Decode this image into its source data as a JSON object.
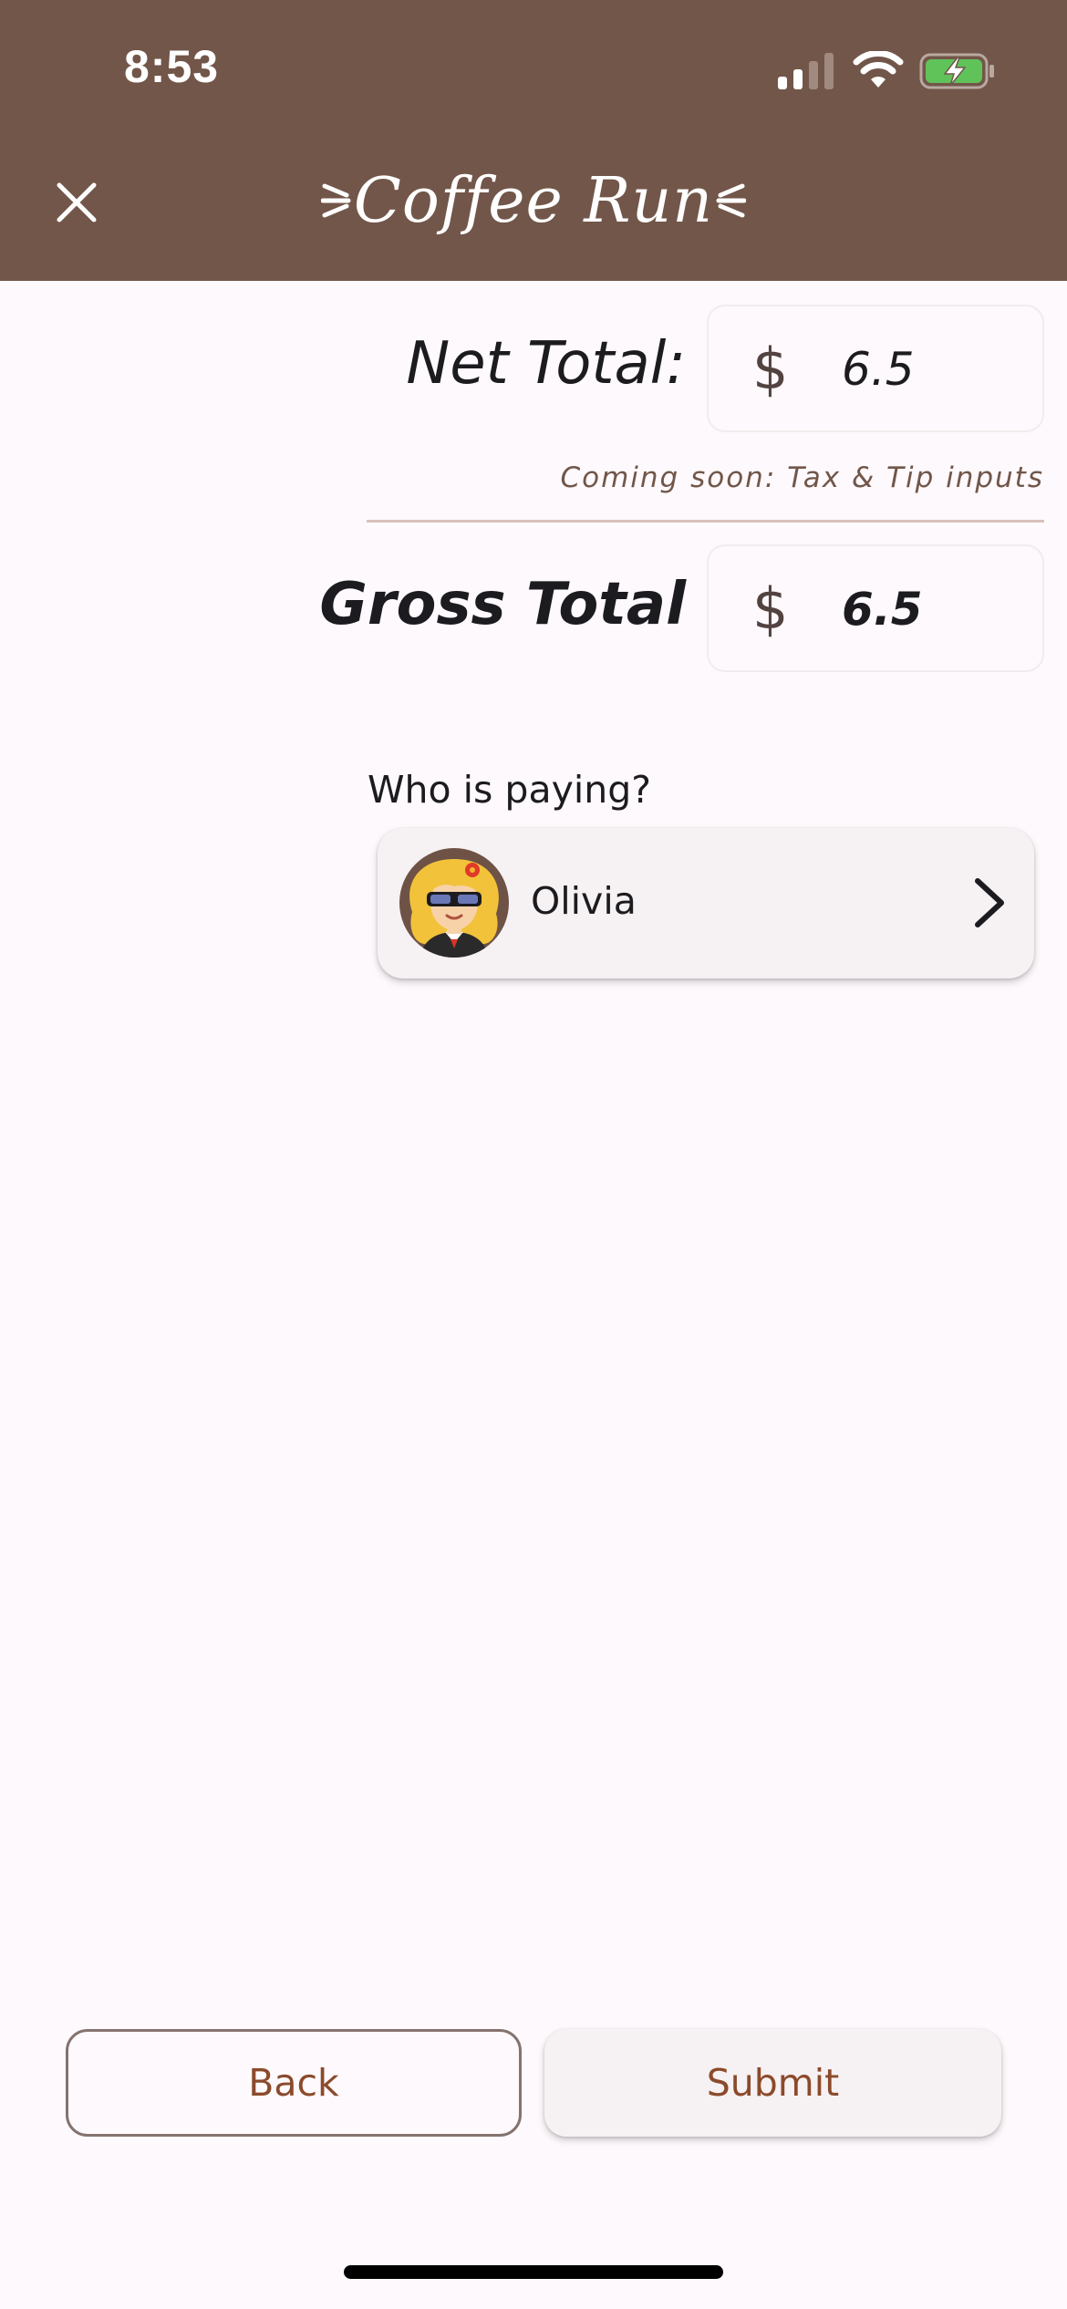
{
  "status_bar": {
    "time": "8:53",
    "icons": [
      "cellular-signal-icon",
      "wifi-icon",
      "battery-charging-icon"
    ]
  },
  "header": {
    "title": "Coffee Run",
    "close_icon": "close-icon",
    "background_color": "#725649"
  },
  "totals": {
    "net_label": "Net Total:",
    "net_currency": "$",
    "net_value": "6.5",
    "note": "Coming soon: Tax & Tip inputs",
    "gross_label": "Gross Total",
    "gross_currency": "$",
    "gross_value": "6.5"
  },
  "payer": {
    "prompt": "Who is paying?",
    "name": "Olivia",
    "avatar_icon": "avatar-icon",
    "chevron_icon": "chevron-right-icon"
  },
  "actions": {
    "back_label": "Back",
    "submit_label": "Submit",
    "accent_color": "#8b4a2b"
  }
}
